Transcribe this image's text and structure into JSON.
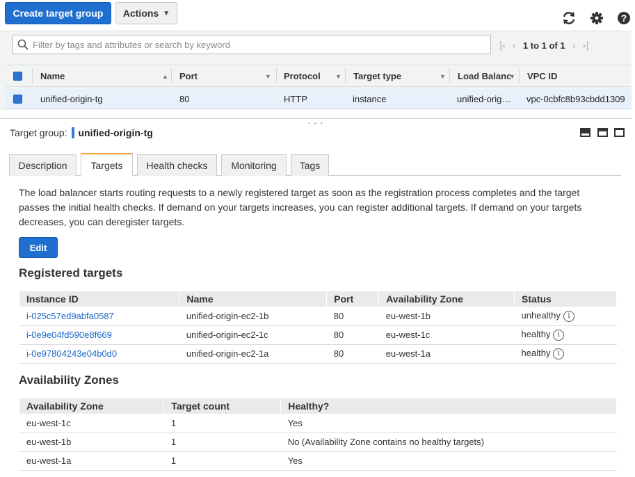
{
  "toolbar": {
    "create_label": "Create target group",
    "actions_label": "Actions"
  },
  "grid": {
    "filter_placeholder": "Filter by tags and attributes or search by keyword",
    "pager_text": "1 to 1 of 1",
    "columns": [
      "Name",
      "Port",
      "Protocol",
      "Target type",
      "Load Balancer",
      "VPC ID"
    ],
    "rows": [
      {
        "name": "unified-origin-tg",
        "port": "80",
        "protocol": "HTTP",
        "target_type": "instance",
        "load_balancer": "unified-orig…",
        "vpc_id": "vpc-0cbfc8b93cbdd1309"
      }
    ]
  },
  "detail": {
    "label": "Target group:",
    "name": "unified-origin-tg"
  },
  "tabs": [
    "Description",
    "Targets",
    "Health checks",
    "Monitoring",
    "Tags"
  ],
  "active_tab": "Targets",
  "targets": {
    "description": "The load balancer starts routing requests to a newly registered target as soon as the registration process completes and the target passes the initial health checks. If demand on your targets increases, you can register additional targets. If demand on your targets decreases, you can deregister targets.",
    "edit_label": "Edit",
    "registered_heading": "Registered targets",
    "registered_columns": [
      "Instance ID",
      "Name",
      "Port",
      "Availability Zone",
      "Status"
    ],
    "registered_rows": [
      {
        "id": "i-025c57ed9abfa0587",
        "name": "unified-origin-ec2-1b",
        "port": "80",
        "az": "eu-west-1b",
        "status": "unhealthy"
      },
      {
        "id": "i-0e9e04fd590e8f669",
        "name": "unified-origin-ec2-1c",
        "port": "80",
        "az": "eu-west-1c",
        "status": "healthy"
      },
      {
        "id": "i-0e97804243e04b0d0",
        "name": "unified-origin-ec2-1a",
        "port": "80",
        "az": "eu-west-1a",
        "status": "healthy"
      }
    ],
    "az_heading": "Availability Zones",
    "az_columns": [
      "Availability Zone",
      "Target count",
      "Healthy?"
    ],
    "az_rows": [
      {
        "az": "eu-west-1c",
        "count": "1",
        "healthy": "Yes"
      },
      {
        "az": "eu-west-1b",
        "count": "1",
        "healthy": "No (Availability Zone contains no healthy targets)"
      },
      {
        "az": "eu-west-1a",
        "count": "1",
        "healthy": "Yes"
      }
    ]
  },
  "icons": {
    "refresh": "refresh-icon",
    "settings": "gear-icon",
    "help": "help-icon",
    "search": "search-icon",
    "info": "info-icon"
  },
  "colors": {
    "primary": "#1f6fd1",
    "link": "#1a66c6",
    "active_tab_accent": "#f29d38",
    "selected_row": "#e8f0fb"
  }
}
